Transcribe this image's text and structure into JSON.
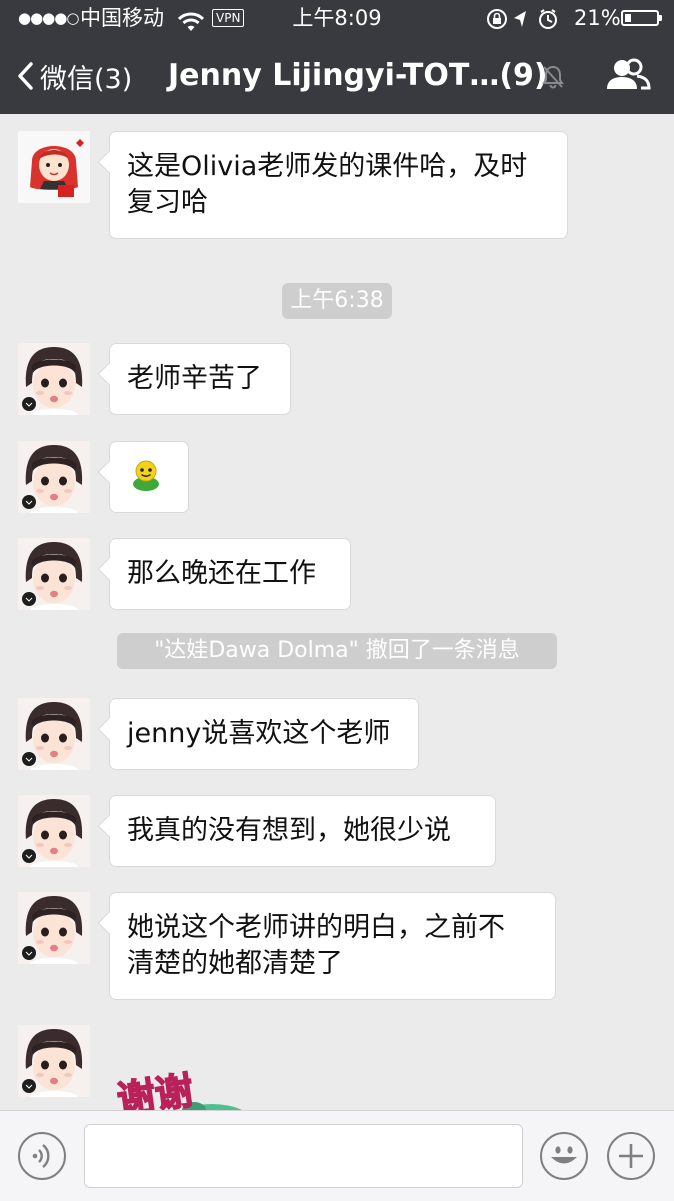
{
  "status_bar": {
    "signal": "●●●●○",
    "carrier": "中国移动",
    "vpn": "VPN",
    "time": "上午8:09",
    "battery": "21%",
    "battery_level": 0.21
  },
  "nav": {
    "back_label": "微信(3)",
    "title": "Jenny Lijingyi-TOT…(9)"
  },
  "messages": [
    {
      "text": "这是Olivia老师发的课件哈，及时复习哈",
      "line1": "这是Olivia老师发的课件哈，及时",
      "line2": "复习哈"
    },
    {
      "timestamp": "上午6:38"
    },
    {
      "text": "老师辛苦了"
    },
    {
      "emoji": "smiley-emoji"
    },
    {
      "text": "那么晚还在工作"
    },
    {
      "system": "\"达娃Dawa Dolma\" 撤回了一条消息"
    },
    {
      "text": "jenny说喜欢这个老师"
    },
    {
      "text": "我真的没有想到，她很少说"
    },
    {
      "line1": "她说这个老师讲的明白，之前不",
      "line2": "清楚的她都清楚了"
    },
    {
      "sticker": "谢谢"
    }
  ],
  "input": {
    "value": "",
    "placeholder": ""
  },
  "colors": {
    "nav_bg": "#393a3f",
    "chat_bg": "#ebebeb",
    "bubble_bg": "#ffffff",
    "system_bg": "#cecece",
    "sticker_pink": "#ff4f8b",
    "sticker_green": "#4fc08d"
  }
}
